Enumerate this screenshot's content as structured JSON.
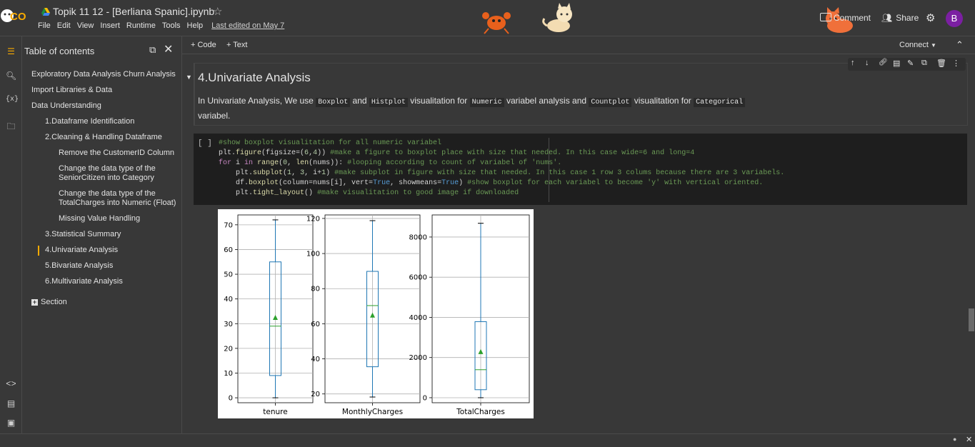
{
  "app": {
    "logo_text": "CO",
    "notebook_title": "Topik 11 12 - [Berliana Spanic].ipynb",
    "last_edited": "Last edited on May 7",
    "menu": [
      "File",
      "Edit",
      "View",
      "Insert",
      "Runtime",
      "Tools",
      "Help"
    ]
  },
  "header_right": {
    "comment_label": "Comment",
    "share_label": "Share",
    "avatar_letter": "B",
    "connect_label": "Connect"
  },
  "toc": {
    "title": "Table of contents",
    "items": [
      "Exploratory Data Analysis Churn Analysis",
      "Import Libraries & Data",
      "Data Understanding",
      "1.Dataframe Identification",
      "2.Cleaning & Handling Dataframe",
      "Remove the CustomerID Column",
      "Change the data type of the SeniorCitizen into Category",
      "Change the data type of the TotalCharges into Numeric (Float)",
      "Missing Value Handling",
      "3.Statistical Summary",
      "4.Univariate Analysis",
      "5.Bivariate Analysis",
      "6.Multivariate Analysis"
    ],
    "section_label": "Section"
  },
  "toolbar": {
    "add_code": "+ Code",
    "add_text": "+ Text"
  },
  "text_cell": {
    "heading": "4.Univariate Analysis",
    "p1": "In Univariate Analysis, We use ",
    "c1": "Boxplot",
    "p2": " and ",
    "c2": "Histplot",
    "p3": " visualitation for ",
    "c3": "Numeric",
    "p4": " variabel analysis and ",
    "c4": "Countplot",
    "p5": " visualitation for ",
    "c5": "Categorical",
    "p6": "variabel."
  },
  "code_cell": {
    "run_marker": "[ ]"
  },
  "colors": {
    "accent": "#f9ab00",
    "avatar": "#7b1fa2",
    "box_line": "#1f77b4",
    "median_line": "#2ca02c",
    "mean_marker": "#2ca02c"
  },
  "chart_data": [
    {
      "type": "boxplot",
      "xlabel": "tenure",
      "yticks": [
        0,
        10,
        20,
        30,
        40,
        50,
        60,
        70
      ],
      "ylim": [
        -2,
        74
      ],
      "min": 0,
      "q1": 9,
      "median": 29,
      "q3": 55,
      "max": 72,
      "mean": 32.4,
      "grid": true
    },
    {
      "type": "boxplot",
      "xlabel": "MonthlyCharges",
      "yticks": [
        20,
        40,
        60,
        80,
        100,
        120
      ],
      "ylim": [
        15,
        122
      ],
      "min": 18.25,
      "q1": 35.5,
      "median": 70.35,
      "q3": 89.85,
      "max": 118.75,
      "mean": 64.76,
      "grid": true
    },
    {
      "type": "boxplot",
      "xlabel": "TotalCharges",
      "yticks": [
        0,
        2000,
        4000,
        6000,
        8000
      ],
      "ylim": [
        -250,
        9100
      ],
      "min": 0,
      "q1": 398,
      "median": 1394,
      "q3": 3786,
      "max": 8684,
      "mean": 2279,
      "grid": true
    }
  ]
}
